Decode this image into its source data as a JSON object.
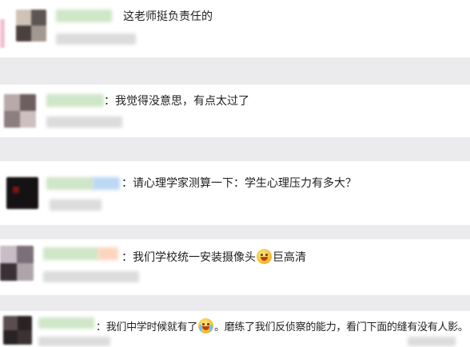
{
  "comments": [
    {
      "text": "这老师挺负责任的"
    },
    {
      "text": "：我觉得没意思，有点太过了"
    },
    {
      "text": "：请心理学家测算一下：学生心理压力有多大？"
    },
    {
      "text_before": "：我们学校统一安装摄像头",
      "emoji": "blush-smile-icon",
      "text_after": "巨高清"
    },
    {
      "text_before": "：我们中学时候就有了",
      "emoji": "laugh-cry-icon",
      "text_after": "。磨练了我们反侦察的能力，看门下面的缝有没有人影。"
    }
  ],
  "colors": {
    "background": "#efeff2",
    "card": "#ffffff",
    "username_blur": "#cfe6c8",
    "meta_blur": "#dcdcdc",
    "accent_blue": "#bcd8f5",
    "accent_peach": "#fcd5c0"
  }
}
